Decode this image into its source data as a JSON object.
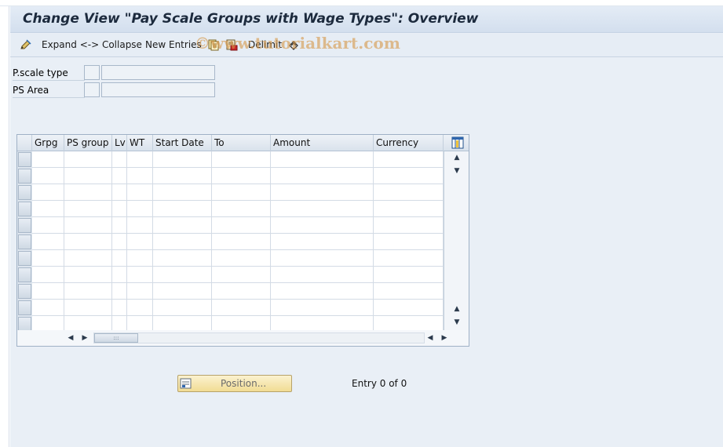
{
  "title": "Change View \"Pay Scale Groups with Wage Types\": Overview",
  "watermark": "©www.tutorialkart.com",
  "toolbar": {
    "expand_collapse_label": "Expand <-> Collapse",
    "new_entries_label": "New Entries",
    "delimit_label": "Delimit"
  },
  "selection": {
    "fields": [
      {
        "label": "P.scale type",
        "value": ""
      },
      {
        "label": "PS Area",
        "value": ""
      }
    ]
  },
  "table": {
    "columns": [
      "Grpg",
      "PS group",
      "Lv",
      "WT",
      "Start Date",
      "To",
      "Amount",
      "Currency"
    ],
    "rows": []
  },
  "position_button_label": "Position...",
  "entry_status": "Entry 0 of 0",
  "colors": {
    "background": "#e9eff6",
    "title_text": "#1c2a3d",
    "position_button": "#f4e3a6"
  }
}
